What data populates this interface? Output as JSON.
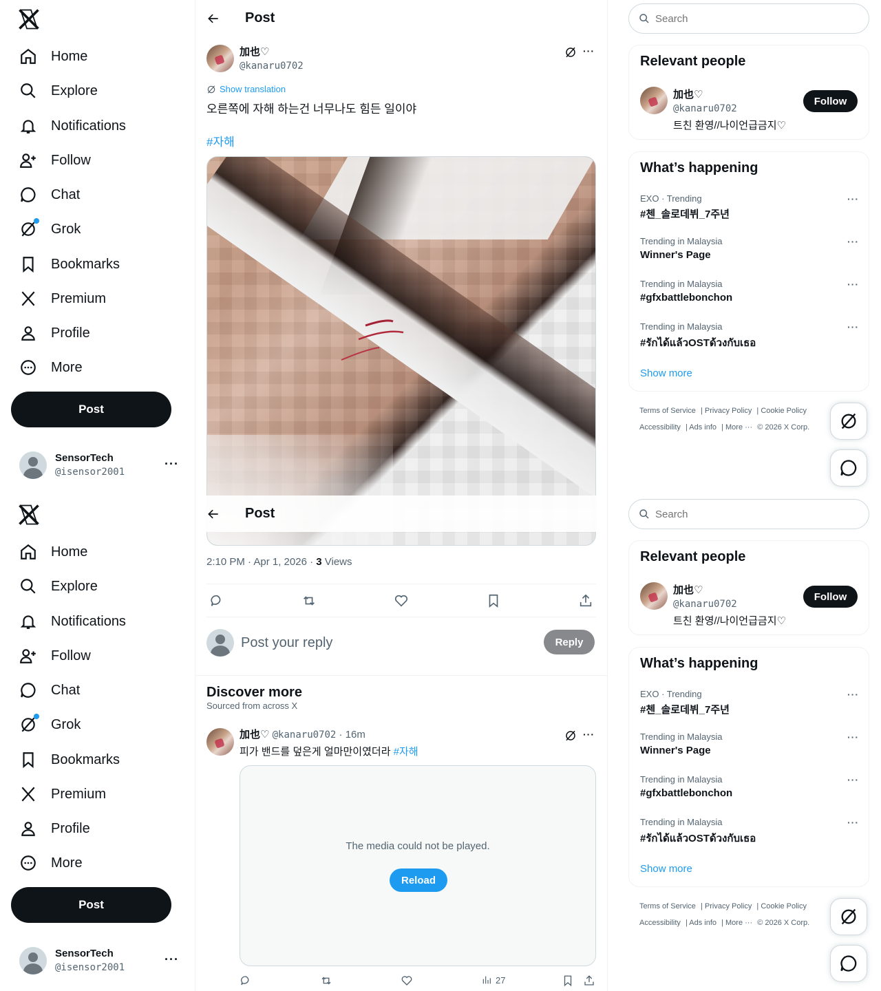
{
  "nav": {
    "items": [
      {
        "label": "Home",
        "icon": "home-icon"
      },
      {
        "label": "Explore",
        "icon": "search-icon"
      },
      {
        "label": "Notifications",
        "icon": "bell-icon"
      },
      {
        "label": "Follow",
        "icon": "person-add-icon"
      },
      {
        "label": "Chat",
        "icon": "chat-icon"
      },
      {
        "label": "Grok",
        "icon": "grok-icon"
      },
      {
        "label": "Bookmarks",
        "icon": "bookmark-icon"
      },
      {
        "label": "Premium",
        "icon": "x-logo-icon"
      },
      {
        "label": "Profile",
        "icon": "person-icon"
      },
      {
        "label": "More",
        "icon": "more-circle-icon"
      }
    ],
    "post_label": "Post",
    "account": {
      "name": "SensorTech",
      "handle": "@isensor2001"
    }
  },
  "header": {
    "title": "Post"
  },
  "tweet": {
    "author_name": "加也♡",
    "author_handle": "@kanaru0702",
    "show_translation": "Show translation",
    "text": "오른쪽에 자해 하는건 너무나도 힘든 일이야",
    "hashtag": "#자해",
    "time": "2:10 PM · Apr 1, 2026 · ",
    "views_count": "3",
    "views_label": " Views"
  },
  "reply": {
    "placeholder": "Post your reply",
    "button": "Reply"
  },
  "discover": {
    "title": "Discover more",
    "subtitle": "Sourced from across X",
    "tweet": {
      "author_name": "加也♡",
      "author_handle": "@kanaru0702",
      "time": "16m",
      "text": "피가 밴드를 덮은게 얼마만이였더라 ",
      "hashtag": "#자해",
      "media_error": "The media could not be played.",
      "reload": "Reload",
      "views": "27"
    }
  },
  "sidebar": {
    "search_placeholder": "Search",
    "relevant": {
      "title": "Relevant people",
      "name": "加也♡",
      "handle": "@kanaru0702",
      "bio": "트친 환영//나이언급금지♡",
      "follow": "Follow"
    },
    "happening": {
      "title": "What’s happening",
      "trends": [
        {
          "context": "EXO · Trending",
          "topic": "#첸_솔로데뷔_7주년"
        },
        {
          "context": "Trending in Malaysia",
          "topic": "Winner's Page"
        },
        {
          "context": "Trending in Malaysia",
          "topic": "#gfxbattlebonchon"
        },
        {
          "context": "Trending in Malaysia",
          "topic": "#รักได้แล้วOSTด้วงกับเธอ"
        }
      ],
      "show_more": "Show more"
    },
    "footer": {
      "terms": "Terms of Service",
      "privacy": "Privacy Policy",
      "cookie": "Cookie Policy",
      "accessibility": "Accessibility",
      "ads": "Ads info",
      "more": "More ···",
      "copyright": "© 2026 X Corp."
    }
  },
  "colors": {
    "accent": "#1d9bf0",
    "text": "#0f1419",
    "muted": "#536471",
    "button_dark": "#0f1419"
  }
}
